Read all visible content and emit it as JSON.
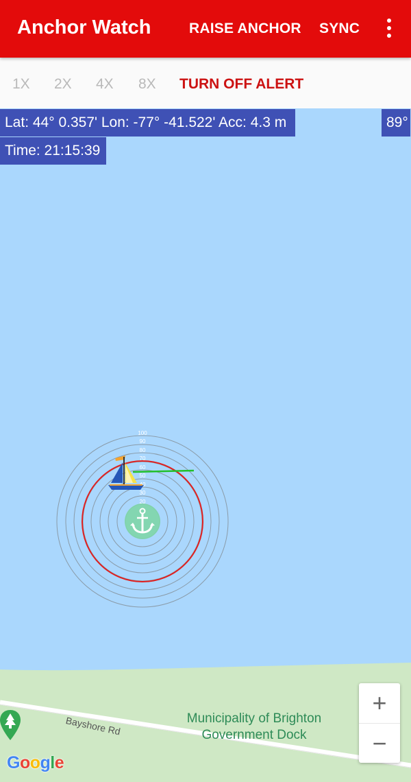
{
  "app": {
    "title": "Anchor Watch",
    "actions": {
      "raise_anchor": "RAISE ANCHOR",
      "sync": "SYNC"
    },
    "accent_color": "#e30b0b"
  },
  "zoom_bar": {
    "levels": [
      "1X",
      "2X",
      "4X",
      "8X"
    ],
    "alert_action": "TURN OFF ALERT"
  },
  "position": {
    "text": "Lat: 44° 0.357' Lon: -77° -41.522' Acc: 4.3 m",
    "heading": "89°",
    "time": "Time: 21:15:39"
  },
  "map": {
    "ring_labels": [
      "100",
      "90",
      "80",
      "70",
      "60",
      "50",
      "40",
      "30",
      "20"
    ],
    "road_name": "Bayshore Rd",
    "poi_name": "Municipality of Brighton Government Dock",
    "zoom_in": "+",
    "zoom_out": "−",
    "attribution": [
      "G",
      "o",
      "o",
      "g",
      "l",
      "e"
    ],
    "colors": {
      "water": "#aad7fd",
      "land": "#cfe8c5",
      "alert_ring": "#e02020",
      "heading_line": "#22c02a"
    }
  }
}
